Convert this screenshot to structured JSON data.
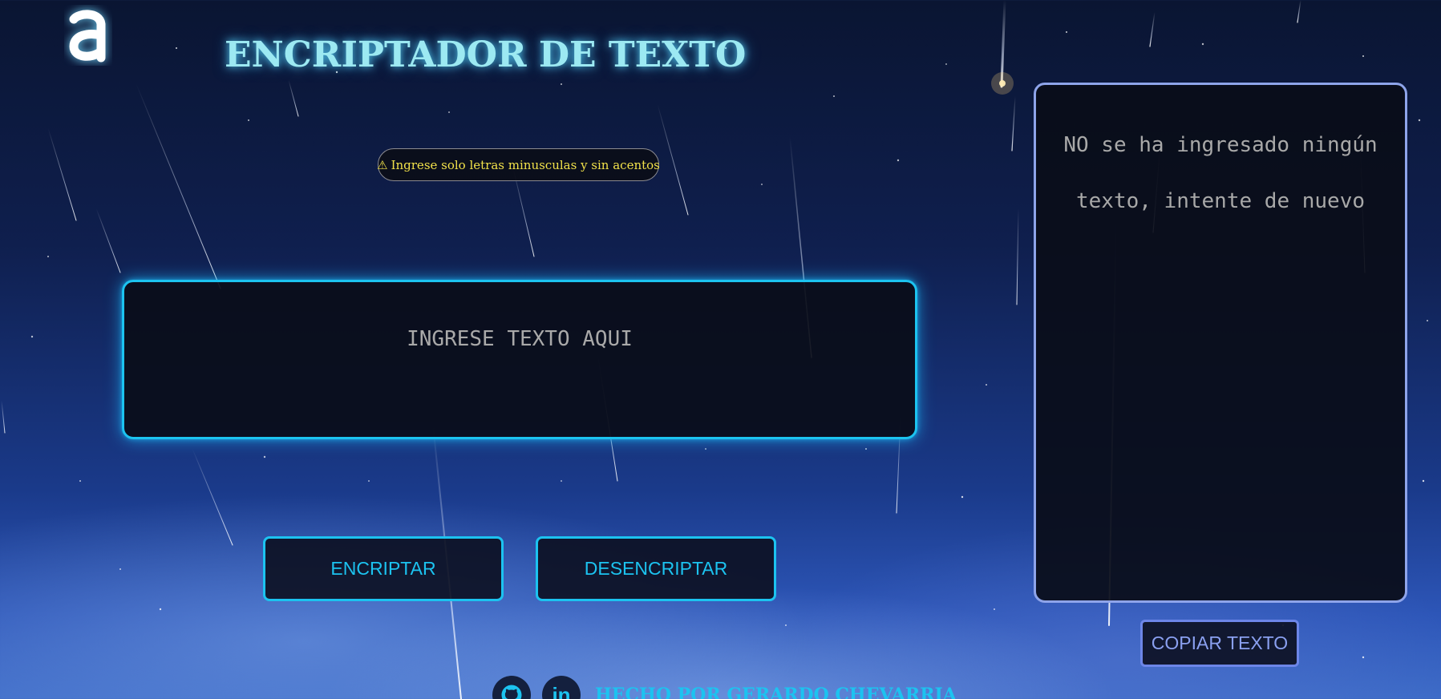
{
  "app": {
    "title": "ENCRIPTADOR DE TEXTO",
    "logo_icon": "alura-a-logo-icon"
  },
  "warning": {
    "icon": "⚠",
    "text": "Ingrese solo letras minusculas y sin acentos",
    "color": "#f1e14a"
  },
  "input": {
    "placeholder": "INGRESE TEXTO AQUI",
    "value": ""
  },
  "buttons": {
    "encrypt_label": "ENCRIPTAR",
    "decrypt_label": "DESENCRIPTAR",
    "copy_label": "COPIAR TEXTO"
  },
  "output": {
    "message": "NO se ha ingresado ningún texto, intente de nuevo"
  },
  "footer": {
    "github_icon": "github-icon",
    "linkedin_icon": "linkedin-icon",
    "linkedin_label": "in",
    "credit": "HECHO POR GERARDO CHEVARRIA"
  },
  "colors": {
    "accent_cyan": "#1cc3f0",
    "accent_periwinkle": "#8ea4ea",
    "title_glow": "#9ce9f2"
  }
}
